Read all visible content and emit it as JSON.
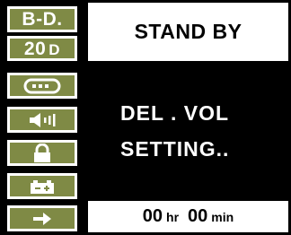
{
  "sidebar": {
    "badges": [
      {
        "label": "B-D."
      },
      {
        "label": "20",
        "suffix": "D"
      }
    ],
    "icons": [
      "record-icon",
      "volume-icon",
      "lock-icon",
      "battery-icon",
      "arrow-right-icon"
    ]
  },
  "status": {
    "text": "STAND BY"
  },
  "message": {
    "line1": "DEL . VOL",
    "line2": "SETTING.."
  },
  "timer": {
    "hours": "00",
    "hours_unit": "hr",
    "minutes": "00",
    "minutes_unit": "min"
  },
  "colors": {
    "button_bg": "#7f8a45",
    "border": "#ffffff",
    "dark": "#000000"
  }
}
